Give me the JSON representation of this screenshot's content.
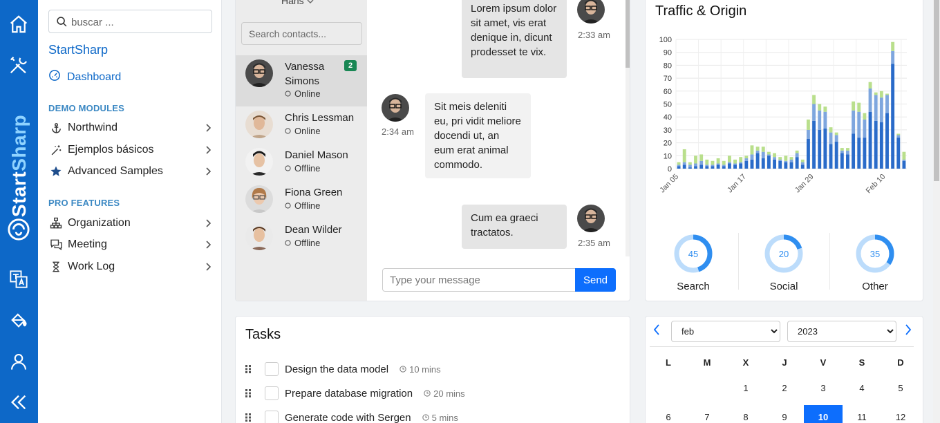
{
  "sidebar": {
    "search": {
      "placeholder": "buscar ..."
    },
    "brand": "StartSharp",
    "dashboard": "Dashboard",
    "sections": [
      {
        "title": "DEMO MODULES",
        "items": [
          {
            "label": "Northwind",
            "icon": "anchor-icon"
          },
          {
            "label": "Ejemplos básicos",
            "icon": "magic-wand-icon"
          },
          {
            "label": "Advanced Samples",
            "icon": "star-icon"
          }
        ]
      },
      {
        "title": "PRO FEATURES",
        "items": [
          {
            "label": "Organization",
            "icon": "sitemap-icon"
          },
          {
            "label": "Meeting",
            "icon": "chat-icon"
          },
          {
            "label": "Work Log",
            "icon": "hourglass-icon"
          }
        ]
      }
    ]
  },
  "rail": {
    "brand_text_1": "Start",
    "brand_text_2": "Sharp"
  },
  "chat": {
    "contacts_header": "Hans",
    "search_placeholder": "Search contacts...",
    "contacts": [
      {
        "name": "Vanessa Simons",
        "status": "Online",
        "badge": "2",
        "active": true
      },
      {
        "name": "Chris Lessman",
        "status": "Online"
      },
      {
        "name": "Daniel Mason",
        "status": "Offline"
      },
      {
        "name": "Fiona Green",
        "status": "Offline"
      },
      {
        "name": "Dean Wilder",
        "status": "Offline"
      }
    ],
    "messages": [
      {
        "text": "Lorem ipsum dolor sit amet, vis erat denique in, dicunt prodesset te vix.",
        "time": "2:33 am",
        "side": "me"
      },
      {
        "text": "Sit meis deleniti eu, pri vidit meliore docendi ut, an eum erat animal commodo.",
        "time": "2:34 am",
        "side": "them"
      },
      {
        "text": "Cum ea graeci tractatos.",
        "time": "2:35 am",
        "side": "me"
      }
    ],
    "input_placeholder": "Type your message",
    "send_label": "Send"
  },
  "traffic": {
    "title": "Traffic & Origin",
    "donuts": [
      {
        "label": "Search",
        "value": 45
      },
      {
        "label": "Social",
        "value": 20
      },
      {
        "label": "Other",
        "value": 35
      }
    ]
  },
  "chart_data": {
    "type": "bar",
    "stacked": true,
    "x_tick_labels": [
      "Jan 05",
      "Jan 17",
      "Jan 29",
      "Feb 10"
    ],
    "ylim": [
      0,
      100
    ],
    "y_ticks": [
      0,
      10,
      20,
      30,
      40,
      50,
      60,
      70,
      80,
      90,
      100
    ],
    "grid": true,
    "colors": [
      "#2a6bc9",
      "#7ea6de",
      "#b9df8c"
    ],
    "series": [
      {
        "values": [
          2,
          3,
          1,
          2,
          3,
          2,
          2,
          3,
          2,
          4,
          3,
          4,
          6,
          7,
          12,
          8,
          10,
          7,
          6,
          5,
          5,
          9,
          3,
          23,
          37,
          30,
          31,
          19,
          21,
          12,
          11,
          27,
          24,
          24,
          44,
          37,
          36,
          43,
          81,
          24,
          6
        ]
      },
      {
        "values": [
          1,
          2,
          2,
          2,
          3,
          1,
          1,
          1,
          1,
          1,
          1,
          1,
          2,
          4,
          2,
          5,
          1,
          2,
          1,
          1,
          2,
          3,
          2,
          7,
          13,
          15,
          13,
          9,
          5,
          2,
          3,
          18,
          20,
          14,
          18,
          20,
          19,
          14,
          10,
          2,
          1
        ]
      },
      {
        "values": [
          2,
          10,
          2,
          6,
          5,
          4,
          3,
          4,
          3,
          5,
          3,
          4,
          2,
          7,
          3,
          4,
          2,
          3,
          2,
          4,
          2,
          2,
          2,
          8,
          7,
          5,
          4,
          4,
          2,
          2,
          2,
          7,
          7,
          5,
          5,
          2,
          5,
          1,
          7,
          1,
          6
        ]
      }
    ]
  },
  "tasks": {
    "title": "Tasks",
    "items": [
      {
        "text": "Design the data model",
        "time": "10 mins"
      },
      {
        "text": "Prepare database migration",
        "time": "20 mins"
      },
      {
        "text": "Generate code with Sergen",
        "time": "5 mins"
      }
    ]
  },
  "calendar": {
    "month": "feb",
    "year": "2023",
    "weekdays": [
      "L",
      "M",
      "X",
      "J",
      "V",
      "S",
      "D"
    ],
    "weeks": [
      [
        "",
        "",
        "1",
        "2",
        "3",
        "4",
        "5"
      ],
      [
        "6",
        "7",
        "8",
        "9",
        "10",
        "11",
        "12"
      ]
    ],
    "selected": "10"
  }
}
